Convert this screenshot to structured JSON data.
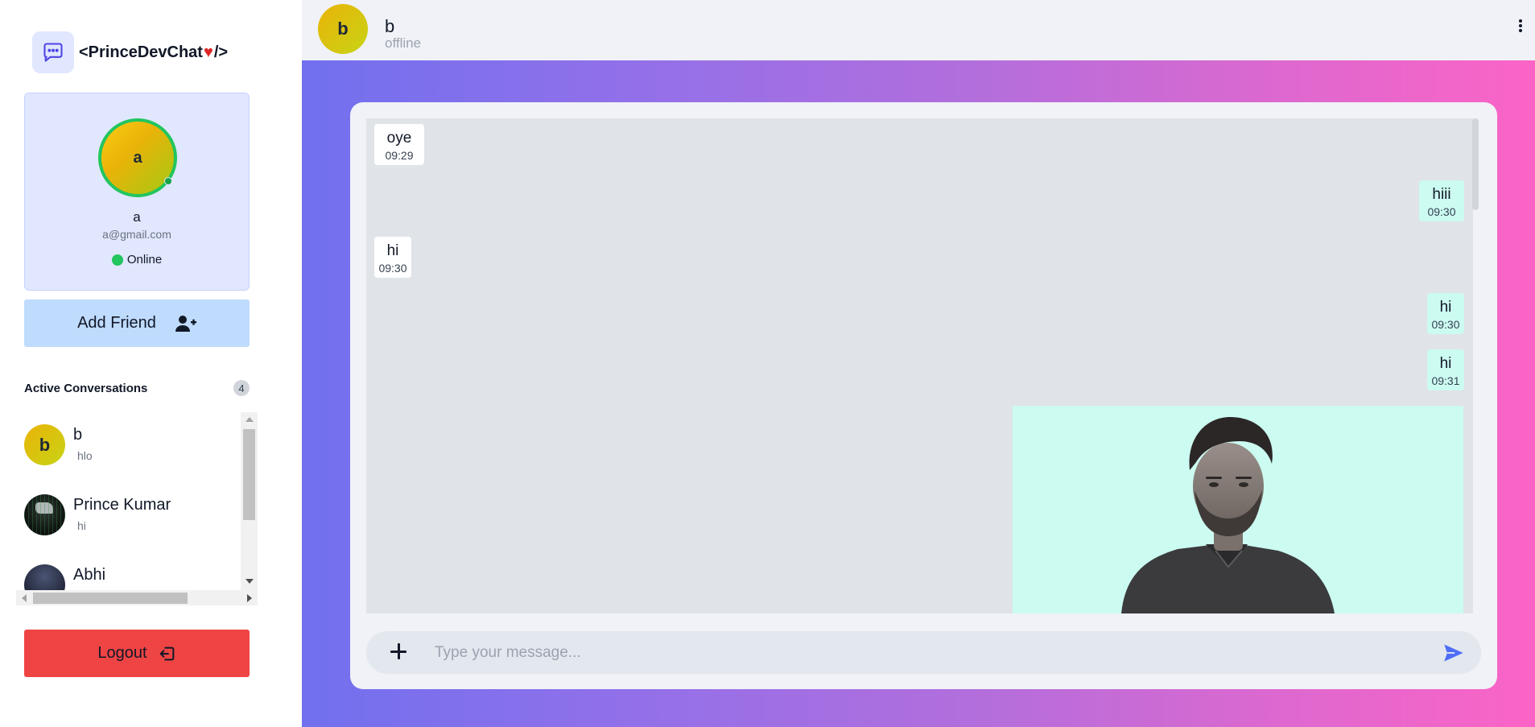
{
  "brand": {
    "name_pre": "<PrinceDevChat",
    "heart": "♥",
    "name_post": "/>"
  },
  "profile": {
    "initial": "a",
    "name": "a",
    "email": "a@gmail.com",
    "status": "Online"
  },
  "add_friend": {
    "label": "Add Friend"
  },
  "conversations": {
    "title": "Active Conversations",
    "count": "4",
    "items": [
      {
        "initial": "b",
        "name": "b",
        "last": "hlo"
      },
      {
        "initial": "",
        "name": "Prince Kumar",
        "last": "hi"
      },
      {
        "initial": "",
        "name": "Abhi",
        "last": ""
      }
    ]
  },
  "logout": {
    "label": "Logout"
  },
  "chat": {
    "initial": "b",
    "name": "b",
    "status": "offline",
    "messages": [
      {
        "direction": "in",
        "text": "oye",
        "time": "09:29"
      },
      {
        "direction": "out",
        "text": "hiii",
        "time": "09:30"
      },
      {
        "direction": "in",
        "text": "hi",
        "time": "09:30"
      },
      {
        "direction": "out",
        "text": "hi",
        "time": "09:30"
      },
      {
        "direction": "out",
        "text": "hi",
        "time": "09:31"
      }
    ],
    "placeholder": "Type your message..."
  },
  "colors": {
    "accent": "#6366f1",
    "online": "#22c55e",
    "logout": "#ef4444",
    "add_friend": "#bfdbfe",
    "outgoing_bubble": "#ccfbf1",
    "gradient_start": "#7170ee",
    "gradient_end": "#fb64c6"
  }
}
